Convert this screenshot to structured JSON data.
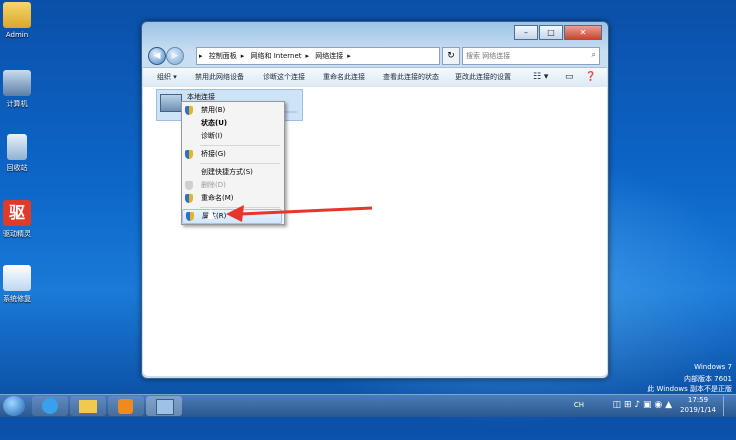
{
  "desktop": {
    "icons": [
      {
        "label": "Admin"
      },
      {
        "label": "计算机"
      },
      {
        "label": "回收站"
      },
      {
        "label": "驱动精灵"
      },
      {
        "label": "系统修复"
      }
    ]
  },
  "window": {
    "address": [
      "控制面板",
      "网络和 Internet",
      "网络连接"
    ],
    "search_placeholder": "搜索 网络连接",
    "toolbar": [
      "组织 ▾",
      "禁用此网络设备",
      "诊断这个连接",
      "重命名此连接",
      "查看此连接的状态",
      "更改此连接的设置"
    ],
    "connection": {
      "name": "本地连接"
    }
  },
  "context_menu": {
    "items": [
      {
        "label": "禁用(B)",
        "shield": true
      },
      {
        "label": "状态(U)",
        "bold": true
      },
      {
        "label": "诊断(I)"
      },
      {
        "label": "桥接(G)",
        "shield": true
      },
      {
        "label": "创建快捷方式(S)"
      },
      {
        "label": "删除(D)",
        "shield": true,
        "disabled": true
      },
      {
        "label": "重命名(M)",
        "shield": true
      },
      {
        "label": "属性(R)",
        "shield": true,
        "highlight": true
      }
    ]
  },
  "watermark": {
    "line1": "Windows 7",
    "line2": "内部版本 7601",
    "line3": "此 Windows 副本不是正版"
  },
  "taskbar": {
    "clock_time": "17:59",
    "clock_date": "2019/1/14",
    "lang": "CH"
  },
  "colors": {
    "arrow": "#e8352b",
    "menu_highlight": "#d3e6fa"
  }
}
